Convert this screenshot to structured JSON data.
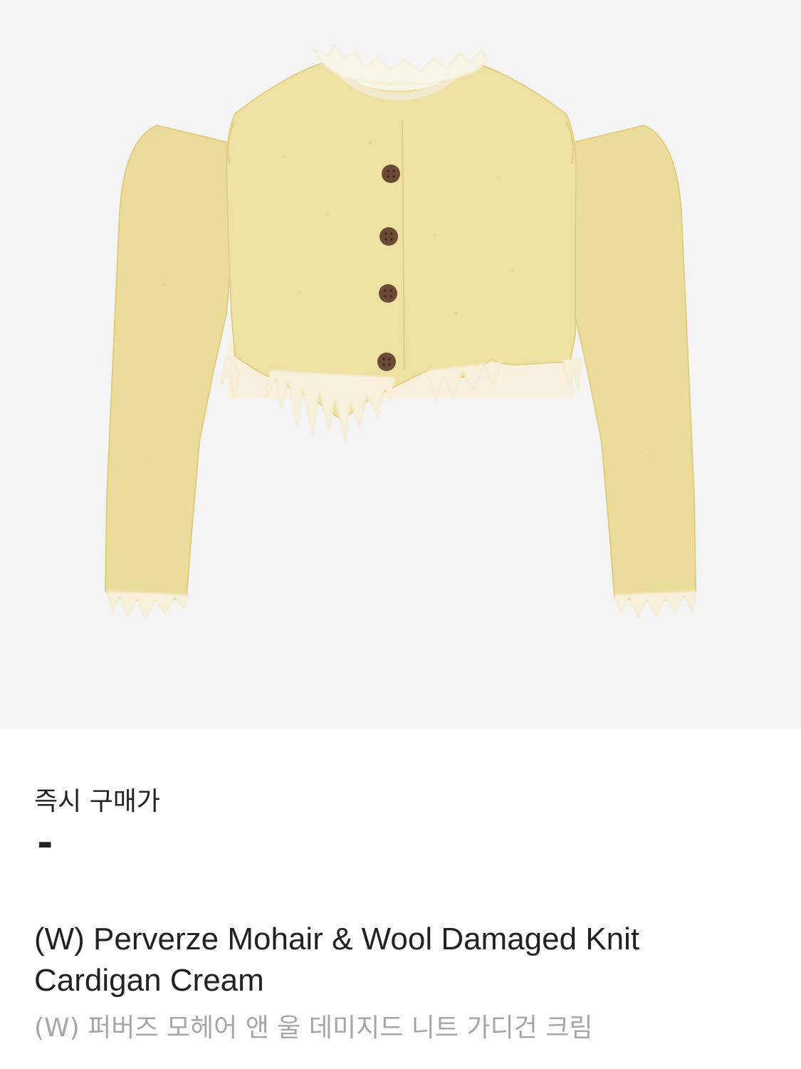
{
  "product": {
    "image_subject": "cream cropped knit cardigan with distressed hems",
    "colors": {
      "background": "#f4f4f4",
      "knit": "#efe1a4",
      "knit_shadow": "#e2cf86",
      "fringe": "#f7f1dc",
      "button": "#6b4a36"
    }
  },
  "price": {
    "label": "즉시 구매가",
    "value": "-"
  },
  "title": "(W) Perverze Mohair & Wool Damaged Knit Cardigan Cream",
  "subtitle": "(W) 퍼버즈 모헤어 앤 울 데미지드 니트 가디건 크림"
}
